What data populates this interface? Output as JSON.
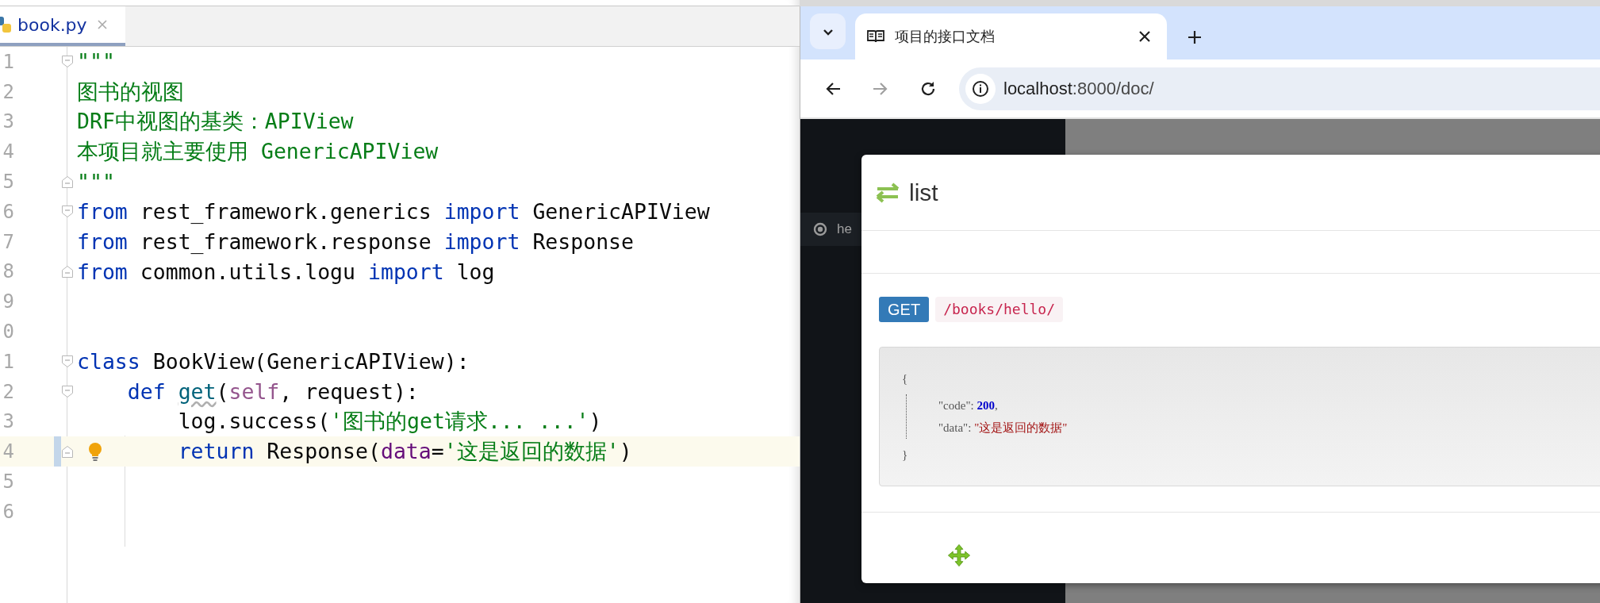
{
  "editor": {
    "tabs": [
      {
        "label": "book.py",
        "selected": true
      }
    ],
    "lines": [
      {
        "number": "1",
        "fold_start": true,
        "fold_end": false,
        "current": false,
        "tokens": [
          {
            "kind": "doc",
            "text": "\"\"\""
          }
        ]
      },
      {
        "number": "2",
        "fold_start": false,
        "fold_end": false,
        "current": false,
        "tokens": [
          {
            "kind": "doc",
            "text": "图书的视图"
          }
        ]
      },
      {
        "number": "3",
        "fold_start": false,
        "fold_end": false,
        "current": false,
        "tokens": [
          {
            "kind": "doc",
            "text": "DRF中视图的基类：APIView"
          }
        ]
      },
      {
        "number": "4",
        "fold_start": false,
        "fold_end": false,
        "current": false,
        "tokens": [
          {
            "kind": "doc",
            "text": "本项目就主要使用 GenericAPIView"
          }
        ]
      },
      {
        "number": "5",
        "fold_start": false,
        "fold_end": true,
        "current": false,
        "tokens": [
          {
            "kind": "doc",
            "text": "\"\"\""
          }
        ]
      },
      {
        "number": "6",
        "fold_start": true,
        "fold_end": false,
        "current": false,
        "tokens": [
          {
            "kind": "kw",
            "text": "from"
          },
          {
            "kind": "plain",
            "text": " rest_framework.generics "
          },
          {
            "kind": "kw",
            "text": "import"
          },
          {
            "kind": "plain",
            "text": " GenericAPIView"
          }
        ]
      },
      {
        "number": "7",
        "fold_start": false,
        "fold_end": false,
        "current": false,
        "tokens": [
          {
            "kind": "kw",
            "text": "from"
          },
          {
            "kind": "plain",
            "text": " rest_framework.response "
          },
          {
            "kind": "kw",
            "text": "import"
          },
          {
            "kind": "plain",
            "text": " Response"
          }
        ]
      },
      {
        "number": "8",
        "fold_start": false,
        "fold_end": true,
        "current": false,
        "tokens": [
          {
            "kind": "kw",
            "text": "from"
          },
          {
            "kind": "plain",
            "text": " common.utils.logu "
          },
          {
            "kind": "kw",
            "text": "import"
          },
          {
            "kind": "plain",
            "text": " log"
          }
        ]
      },
      {
        "number": "9",
        "fold_start": false,
        "fold_end": false,
        "current": false
      },
      {
        "number": "0",
        "fold_start": false,
        "fold_end": false,
        "current": false
      },
      {
        "number": "1",
        "fold_start": true,
        "fold_end": false,
        "current": false,
        "tokens": [
          {
            "kind": "kw",
            "text": "class"
          },
          {
            "kind": "plain",
            "text": " BookView(GenericAPIView):"
          }
        ]
      },
      {
        "number": "2",
        "fold_start": true,
        "fold_end": false,
        "current": false,
        "tokens": [
          {
            "kind": "kw",
            "text": "    def "
          },
          {
            "kind": "fn",
            "text": "get"
          },
          {
            "kind": "plain",
            "text": "("
          },
          {
            "kind": "self",
            "text": "self"
          },
          {
            "kind": "plain",
            "text": ", request):"
          }
        ]
      },
      {
        "number": "3",
        "fold_start": false,
        "fold_end": false,
        "current": false,
        "tokens": [
          {
            "kind": "plain",
            "text": "        log.success("
          },
          {
            "kind": "str",
            "text": "'图书的get请求... ...'"
          },
          {
            "kind": "plain",
            "text": ")"
          }
        ]
      },
      {
        "number": "4",
        "fold_start": false,
        "fold_end": true,
        "current": true,
        "tokens": [
          {
            "kind": "kw",
            "text": "        return"
          },
          {
            "kind": "plain",
            "text": " Response("
          },
          {
            "kind": "param",
            "text": "data"
          },
          {
            "kind": "plain",
            "text": "="
          },
          {
            "kind": "str",
            "text": "'这是返回的数据'"
          },
          {
            "kind": "plain",
            "text": ")"
          }
        ]
      },
      {
        "number": "5",
        "fold_start": false,
        "fold_end": false,
        "current": false
      },
      {
        "number": "6",
        "fold_start": false,
        "fold_end": false,
        "current": false
      }
    ]
  },
  "browser": {
    "tabs": [
      {
        "title": "项目的接口文档",
        "selected": true
      }
    ],
    "nav_buttons": [
      {
        "kind": "back",
        "disabled": false
      },
      {
        "kind": "forward",
        "disabled": true
      },
      {
        "kind": "reload",
        "disabled": false
      }
    ],
    "address": {
      "host": "localhost",
      "rest": ":8000/doc/"
    },
    "sidebar": {
      "items": [
        {
          "label": "he"
        }
      ]
    },
    "modal": {
      "title": "list",
      "method": "GET",
      "path": "/books/hello/",
      "response": {
        "open": "{",
        "close": "}",
        "fields": [
          {
            "key": "\"code\"",
            "sep": ": ",
            "value": "200",
            "kind": "number",
            "trail": ","
          },
          {
            "key": "\"data\"",
            "sep": ": ",
            "value": "\"这是返回的数据\"",
            "kind": "string"
          }
        ]
      }
    }
  }
}
